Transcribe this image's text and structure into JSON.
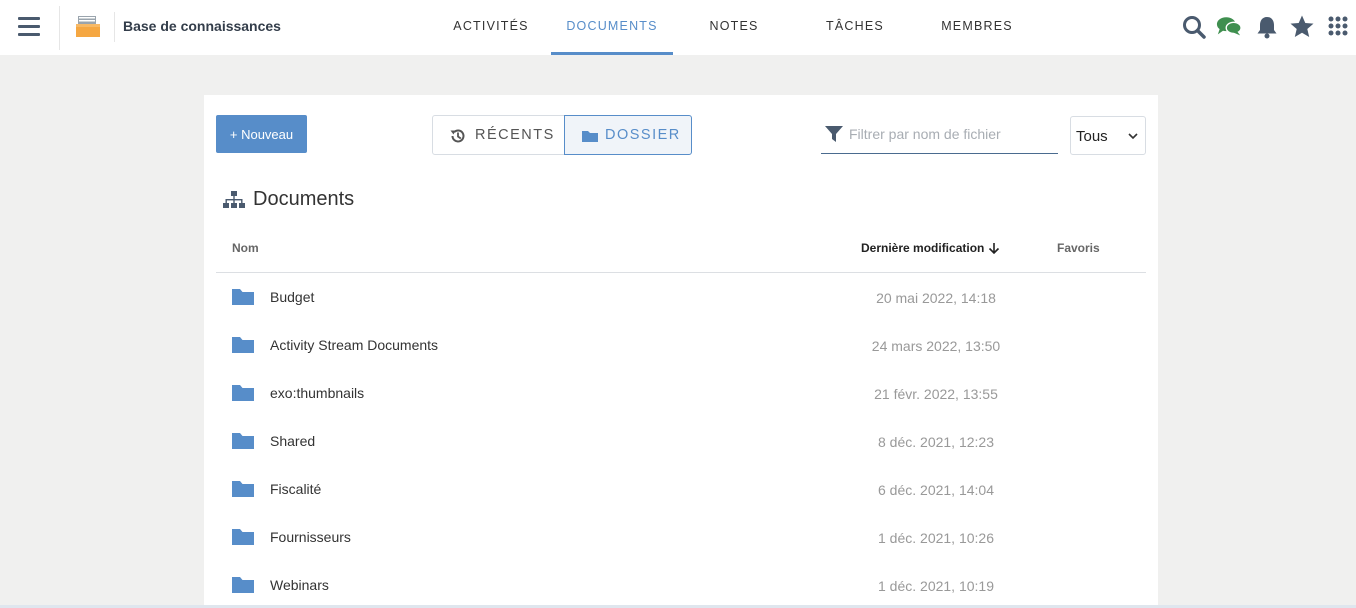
{
  "topbar": {
    "space_title": "Base de connaissances",
    "tabs": [
      "ACTIVITÉS",
      "DOCUMENTS",
      "NOTES",
      "TÂCHES",
      "MEMBRES"
    ],
    "active_tab": "DOCUMENTS",
    "icons": [
      "search-icon",
      "chat-icon",
      "bell-icon",
      "star-icon",
      "apps-grid-icon"
    ]
  },
  "toolbar": {
    "new_label": "Nouveau",
    "view_recent_label": "RÉCENTS",
    "view_folder_label": "DOSSIER",
    "active_view": "DOSSIER",
    "filter_placeholder": "Filtrer par nom de fichier",
    "select_value": "Tous"
  },
  "breadcrumb": {
    "title": "Documents"
  },
  "table": {
    "columns": {
      "name": "Nom",
      "modified": "Dernière modification",
      "favorites": "Favoris"
    },
    "sort": "Dernière modification descending",
    "rows": [
      {
        "name": "Budget",
        "modified": "20 mai 2022, 14:18"
      },
      {
        "name": "Activity Stream Documents",
        "modified": "24 mars 2022, 13:50"
      },
      {
        "name": "exo:thumbnails",
        "modified": "21 févr. 2022, 13:55"
      },
      {
        "name": "Shared",
        "modified": "8 déc. 2021, 12:23"
      },
      {
        "name": "Fiscalité",
        "modified": "6 déc. 2021, 14:04"
      },
      {
        "name": "Fournisseurs",
        "modified": "1 déc. 2021, 10:26"
      },
      {
        "name": "Webinars",
        "modified": "1 déc. 2021, 10:19"
      }
    ]
  },
  "colors": {
    "accent": "#578dc9",
    "icon_dark": "#4a5a6e",
    "chat_green": "#3f8f4f",
    "folder_blue": "#578dc9"
  }
}
